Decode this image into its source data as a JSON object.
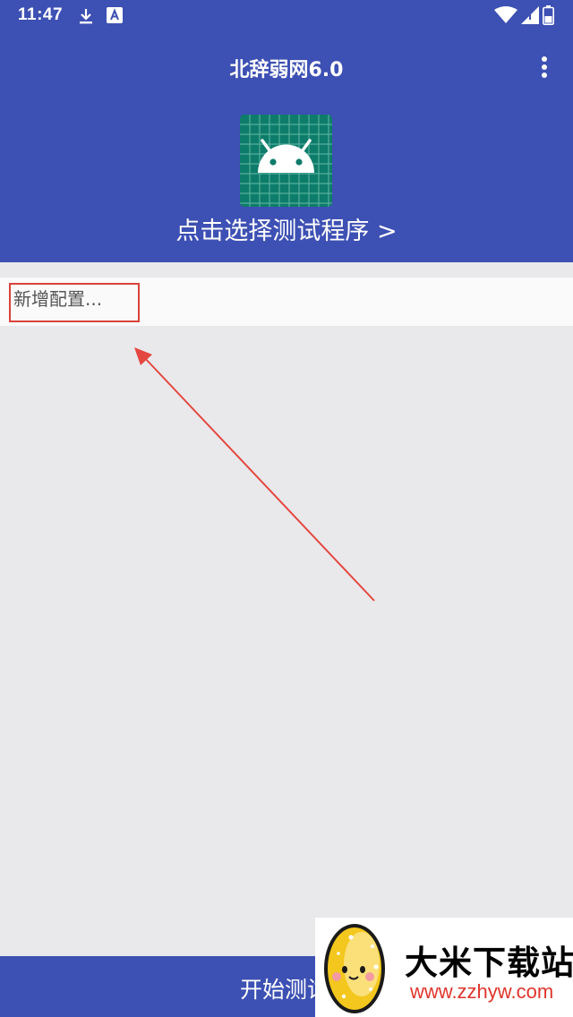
{
  "status_bar": {
    "time": "11:47",
    "icons": [
      "download-icon",
      "font-app-icon",
      "wifi-icon",
      "signal-icon",
      "battery-icon"
    ]
  },
  "toolbar": {
    "title": "北辞弱网6.0",
    "overflow_icon": "more-vert-icon"
  },
  "header": {
    "app_icon": "android-robot-icon",
    "select_program_label": "点击选择测试程序 >"
  },
  "config": {
    "add_config_label": "新增配置..."
  },
  "bottom": {
    "start_label": "开始测试"
  },
  "watermark": {
    "name": "大米下载站",
    "url": "www.zzhyw.com"
  },
  "colors": {
    "primary": "#3D50B3",
    "background": "#E9E9EC",
    "icon_bg": "#0E7C6A",
    "highlight_red": "#D9423A"
  }
}
